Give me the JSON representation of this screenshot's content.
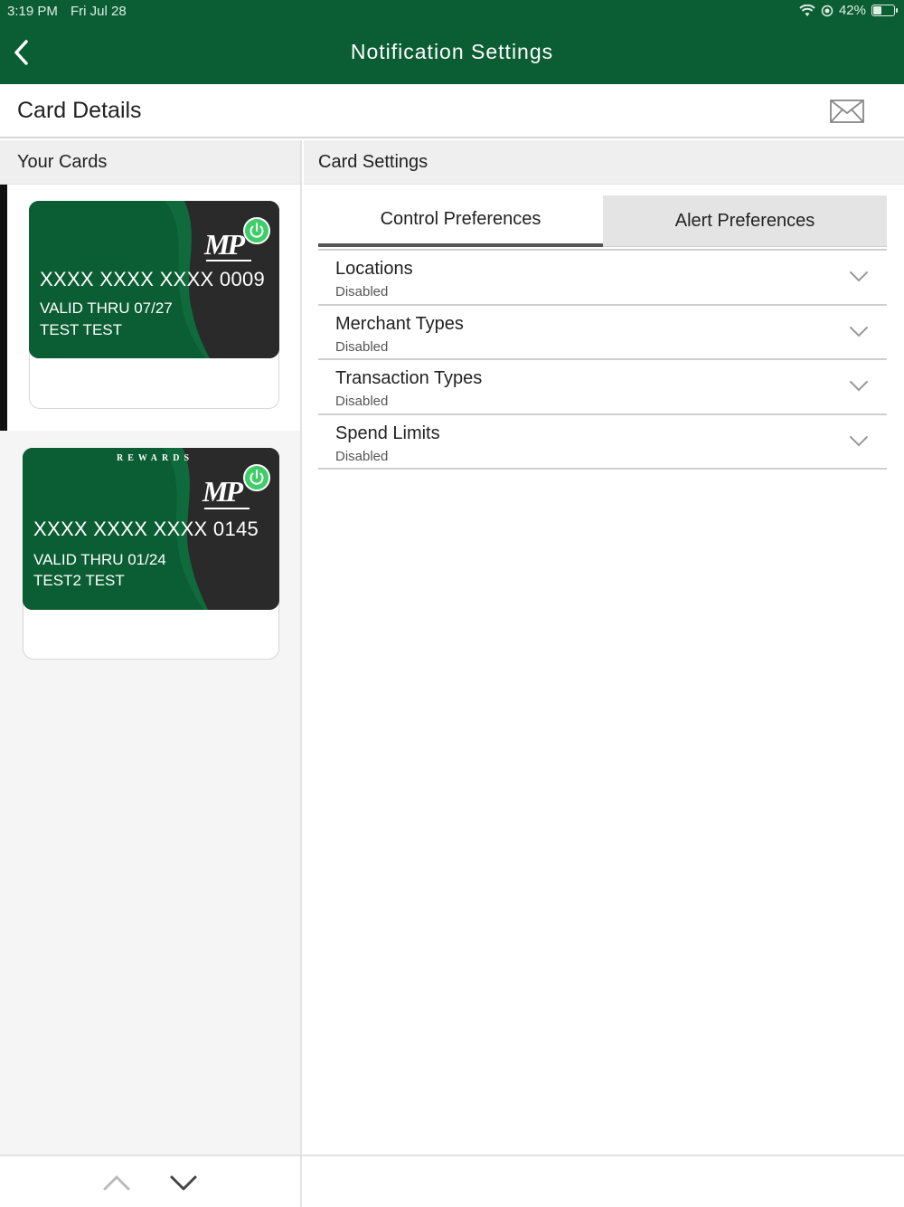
{
  "status_bar": {
    "time": "3:19 PM",
    "date": "Fri Jul 28",
    "battery": "42%",
    "battery_level": 0.42,
    "icons": [
      "wifi-icon",
      "location-lock-icon",
      "battery-icon"
    ]
  },
  "nav": {
    "title": "Notification Settings",
    "back_icon": "chevron-left-icon"
  },
  "details": {
    "title": "Card Details",
    "mail_icon": "envelope-icon"
  },
  "cards_panel": {
    "header": "Your Cards",
    "cards": [
      {
        "number": "XXXX XXXX XXXX 0009",
        "valid": "VALID THRU 07/27",
        "name": "TEST TEST",
        "logo": "MP",
        "selected": true,
        "power_icon": "power-icon"
      },
      {
        "rewards_label": "REWARDS",
        "number": "XXXX XXXX XXXX 0145",
        "valid": "VALID THRU 01/24",
        "name": "TEST2 TEST",
        "logo": "MP",
        "selected": false,
        "power_icon": "power-icon"
      }
    ]
  },
  "settings_panel": {
    "header": "Card Settings",
    "tabs": [
      {
        "label": "Control Preferences",
        "active": true
      },
      {
        "label": "Alert Preferences",
        "active": false
      }
    ],
    "preferences": [
      {
        "title": "Locations",
        "status": "Disabled"
      },
      {
        "title": "Merchant Types",
        "status": "Disabled"
      },
      {
        "title": "Transaction Types",
        "status": "Disabled"
      },
      {
        "title": "Spend Limits",
        "status": "Disabled"
      }
    ]
  },
  "bottom_nav": {
    "up_icon": "chevron-up-icon",
    "down_icon": "chevron-down-icon"
  },
  "colors": {
    "brand_green": "#0b5e33",
    "card_dark": "#2a2a2a",
    "power_green": "#3fcd6a"
  }
}
